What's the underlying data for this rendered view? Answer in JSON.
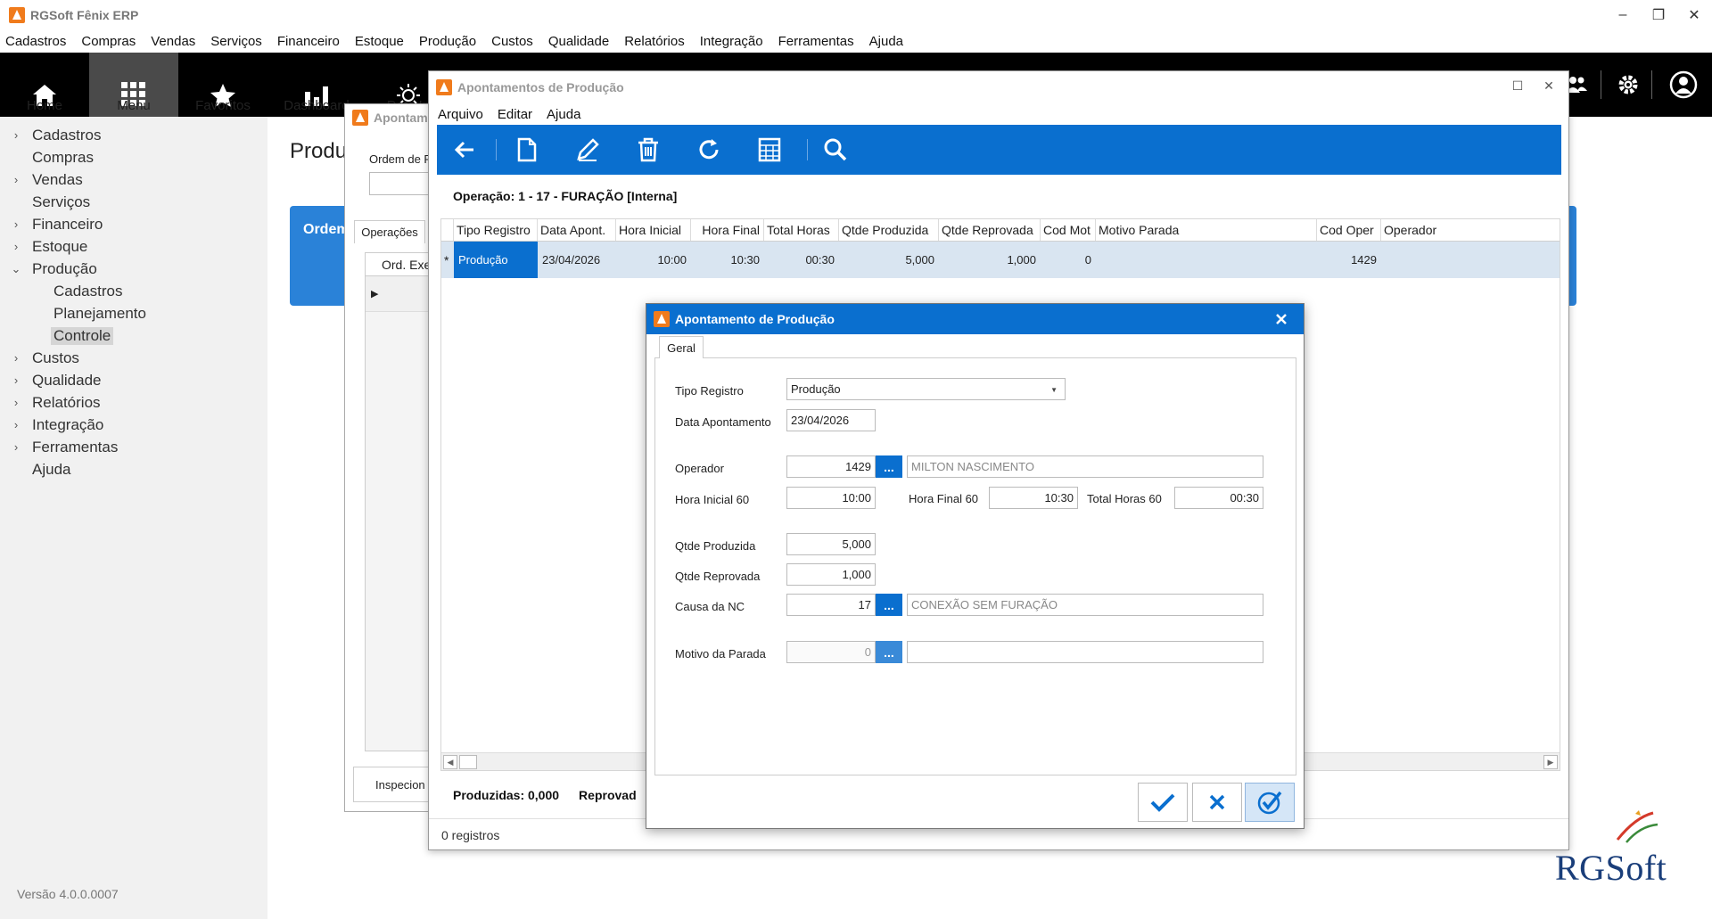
{
  "app": {
    "title": "RGSoft Fênix ERP",
    "version": "Versão 4.0.0.0007",
    "logo_text": "RGSoft",
    "accent": "#0a6fcf"
  },
  "menubar": [
    "Cadastros",
    "Compras",
    "Vendas",
    "Serviços",
    "Financeiro",
    "Estoque",
    "Produção",
    "Custos",
    "Qualidade",
    "Relatórios",
    "Integração",
    "Ferramentas",
    "Ajuda"
  ],
  "mainbar": {
    "home": "Home",
    "menu": "Menu",
    "favoritos": "Favoritos",
    "dashboard": "Dashboard",
    "data": "Data In"
  },
  "sidebar": {
    "items": [
      {
        "label": "Cadastros"
      },
      {
        "label": "Compras"
      },
      {
        "label": "Vendas"
      },
      {
        "label": "Serviços"
      },
      {
        "label": "Financeiro"
      },
      {
        "label": "Estoque"
      },
      {
        "label": "Produção"
      },
      {
        "label": "Cadastros"
      },
      {
        "label": "Planejamento"
      },
      {
        "label": "Controle"
      },
      {
        "label": "Custos"
      },
      {
        "label": "Qualidade"
      },
      {
        "label": "Relatórios"
      },
      {
        "label": "Integração"
      },
      {
        "label": "Ferramentas"
      },
      {
        "label": "Ajuda"
      }
    ]
  },
  "background": {
    "page_title": "Produ",
    "banner_text": "Ordem"
  },
  "win1": {
    "title": "Apontam",
    "order_label": "Ordem de F",
    "tab": "Operações",
    "grid_header": "Ord. Exe",
    "button": "Inspecion"
  },
  "win2": {
    "title": "Apontamentos de Produção",
    "menu": [
      "Arquivo",
      "Editar",
      "Ajuda"
    ],
    "operation": "Operação: 1 - 17 - FURAÇÃO  [Interna]",
    "columns": [
      "Tipo Registro",
      "Data Apont.",
      "Hora Inicial",
      "Hora Final",
      "Total Horas",
      "Qtde Produzida",
      "Qtde Reprovada",
      "Cod Mot",
      "Motivo Parada",
      "Cod Oper",
      "Operador"
    ],
    "row": {
      "marker": "*",
      "tipo": "Produção",
      "data": "23/04/2026",
      "hora_inicial": "10:00",
      "hora_final": "10:30",
      "total_horas": "00:30",
      "qtde_produzida": "5,000",
      "qtde_reprovada": "1,000",
      "cod_mot": "0",
      "motivo": "",
      "cod_oper": "1429",
      "operador": ""
    },
    "footer_produzidas": "Produzidas: 0,000",
    "footer_reprovadas": "Reprovad",
    "status": "0 registros"
  },
  "dialog": {
    "title": "Apontamento de Produção",
    "tab": "Geral",
    "tipo_registro_label": "Tipo Registro",
    "tipo_registro_value": "Produção",
    "data_label": "Data Apontamento",
    "data_value": "23/04/2026",
    "operador_label": "Operador",
    "operador_code": "1429",
    "operador_name": "MILTON NASCIMENTO",
    "hora_inicial_label": "Hora Inicial 60",
    "hora_inicial_value": "10:00",
    "hora_final_label": "Hora Final 60",
    "hora_final_value": "10:30",
    "total_horas_label": "Total Horas 60",
    "total_horas_value": "00:30",
    "qtde_produzida_label": "Qtde Produzida",
    "qtde_produzida_value": "5,000",
    "qtde_reprovada_label": "Qtde Reprovada",
    "qtde_reprovada_value": "1,000",
    "causa_label": "Causa da NC",
    "causa_code": "17",
    "causa_desc": "CONEXÃO SEM FURAÇÃO",
    "motivo_label": "Motivo da Parada",
    "motivo_code": "0",
    "motivo_desc": "",
    "lookup_button": "..."
  }
}
